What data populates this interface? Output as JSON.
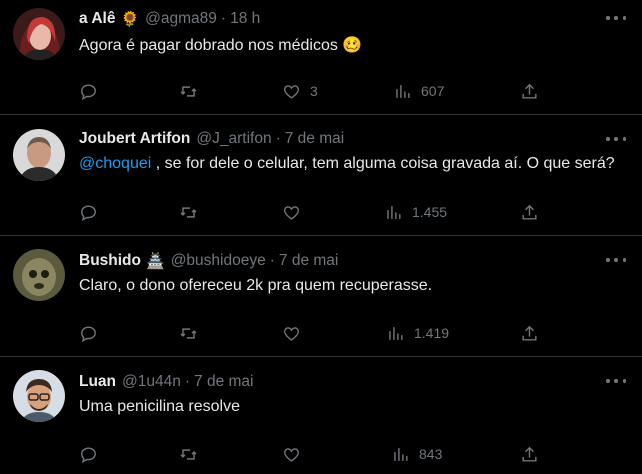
{
  "tweets": [
    {
      "name": "a Alê",
      "name_emoji": "🌻",
      "handle": "@agma89",
      "separator": "·",
      "time": "18 h",
      "text": "Agora é pagar dobrado nos médicos",
      "text_emoji": "🥴",
      "likes": "3",
      "views": "607"
    },
    {
      "name": "Joubert Artifon",
      "handle": "@J_artifon",
      "separator": "·",
      "time": "7 de mai",
      "mention": "@choquei",
      "text": " , se for dele o celular, tem alguma coisa gravada aí. O que será?",
      "views": "1.455"
    },
    {
      "name": "Bushido",
      "name_emoji": "🏯",
      "handle": "@bushidoeye",
      "separator": "·",
      "time": "7 de mai",
      "text": "Claro, o dono ofereceu 2k pra quem recuperasse.",
      "views": "1.419"
    },
    {
      "name": "Luan",
      "handle": "@1u44n",
      "separator": "·",
      "time": "7 de mai",
      "text": "Uma penicilina resolve",
      "views": "843"
    }
  ],
  "icons": {
    "reply": "reply-icon",
    "retweet": "retweet-icon",
    "like": "heart-icon",
    "views": "views-icon",
    "share": "share-icon",
    "more": "more-icon"
  },
  "colors": {
    "background": "#000000",
    "text": "#e7e9ea",
    "muted": "#71767b",
    "link": "#1d9bf0",
    "divider": "#2f3336"
  }
}
